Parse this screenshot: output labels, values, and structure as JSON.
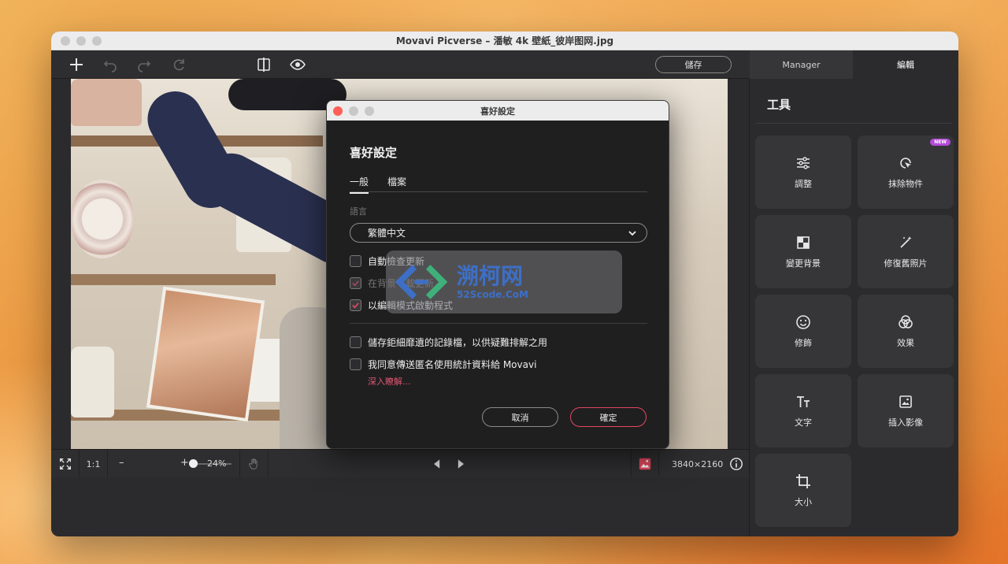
{
  "window": {
    "title": "Movavi Picverse – 潘敏 4k 壁紙_彼岸图网.jpg"
  },
  "toolbar": {
    "save_label": "儲存",
    "tabs": [
      {
        "label": "Manager"
      },
      {
        "label": "編輯"
      }
    ]
  },
  "bottom_bar": {
    "ratio_label": "1:1",
    "zoom_minus": "–",
    "zoom_plus": "+",
    "zoom": "24%",
    "zoom_fraction": 0.24,
    "dimensions": "3840×2160"
  },
  "sidebar": {
    "heading": "工具",
    "new_badge": "NEW",
    "tools": [
      {
        "label": "調整",
        "icon": "sliders-icon"
      },
      {
        "label": "抹除物件",
        "icon": "eraser-cursor-icon"
      },
      {
        "label": "變更背景",
        "icon": "background-icon"
      },
      {
        "label": "修復舊照片",
        "icon": "magic-wand-icon"
      },
      {
        "label": "修飾",
        "icon": "smile-icon"
      },
      {
        "label": "效果",
        "icon": "circles-icon"
      },
      {
        "label": "文字",
        "icon": "text-icon"
      },
      {
        "label": "插入影像",
        "icon": "image-icon"
      },
      {
        "label": "大小",
        "icon": "crop-icon"
      }
    ]
  },
  "dialog": {
    "window_title": "喜好設定",
    "heading": "喜好設定",
    "tabs": [
      {
        "label": "一般"
      },
      {
        "label": "檔案"
      }
    ],
    "language_label": "語言",
    "language_value": "繁體中文",
    "options": [
      {
        "label": "自動檢查更新",
        "checked": false
      },
      {
        "label": "在背景下載更新",
        "checked": true,
        "disabled": true
      },
      {
        "label": "以編輯模式啟動程式",
        "checked": true
      },
      {
        "label": "儲存鉅細靡遺的記錄檔，以供疑難排解之用",
        "checked": false
      },
      {
        "label": "我同意傳送匿名使用統計資料給 Movavi",
        "checked": false
      }
    ],
    "learn_more": "深入瞭解...",
    "cancel_label": "取消",
    "ok_label": "確定"
  },
  "watermark": {
    "title": "溯柯网",
    "subtitle": "52Scode.CoM"
  },
  "colors": {
    "accent": "#e3475f",
    "badge": "#b54ad8",
    "watermark": "#3d6fc7"
  }
}
